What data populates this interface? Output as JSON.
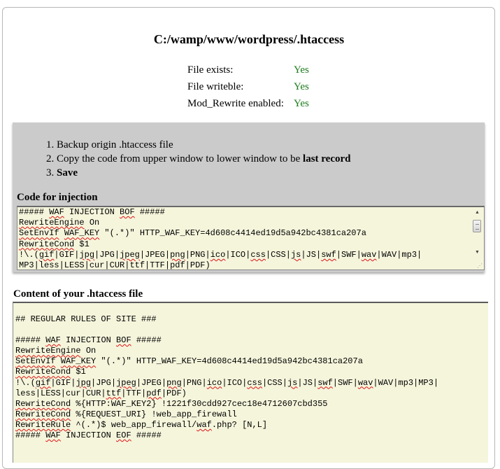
{
  "header": {
    "title": "C:/wamp/www/wordpress/.htaccess"
  },
  "status": [
    {
      "label": "File exists:",
      "value": "Yes"
    },
    {
      "label": "File writeble:",
      "value": "Yes"
    },
    {
      "label": "Mod_Rewrite enabled:",
      "value": "Yes"
    }
  ],
  "colors": {
    "status_ok": "#1a7a1a",
    "panel_gray": "#cbcbcb",
    "textarea_bg": "#f5f5dc"
  },
  "instructions": {
    "step1": "Backup origin .htaccess file",
    "step2_text": "Copy the code from upper window to lower window to be ",
    "step2_bold": "last record",
    "step3": "Save"
  },
  "injection": {
    "label": "Code for injection",
    "lines": [
      "##### WAF INJECTION BOF #####",
      "RewriteEngine On",
      "SetEnvIf WAF_KEY \"(.*)\" HTTP_WAF_KEY=4d608c4414ed19d5a942bc4381ca207a",
      "RewriteCond $1",
      "!\\.(gif|GIF|jpg|JPG|jpeg|JPEG|png|PNG|ico|ICO|css|CSS|js|JS|swf|SWF|wav|WAV|mp3|",
      "MP3|less|LESS|cur|CUR|ttf|TTF|pdf|PDF)"
    ]
  },
  "content": {
    "label": "Content of your .htaccess file",
    "lines": [
      "## REGULAR RULES OF SITE ###",
      "",
      "##### WAF INJECTION BOF #####",
      "RewriteEngine On",
      "SetEnvIf WAF_KEY \"(.*)\" HTTP_WAF_KEY=4d608c4414ed19d5a942bc4381ca207a",
      "RewriteCond $1",
      "!\\.(gif|GIF|jpg|JPG|jpeg|JPEG|png|PNG|ico|ICO|css|CSS|js|JS|swf|SWF|wav|WAV|mp3|MP3|",
      "less|LESS|cur|CUR|ttf|TTF|pdf|PDF)",
      "RewriteCond %{HTTP:WAF_KEY2} !1221f30cdd927cec18e4712607cbd355",
      "RewriteCond %{REQUEST_URI} !web_app_firewall",
      "RewriteRule ^(.*)$ web_app_firewall/waf.php? [N,L]",
      "##### WAF INJECTION EOF #####"
    ]
  }
}
